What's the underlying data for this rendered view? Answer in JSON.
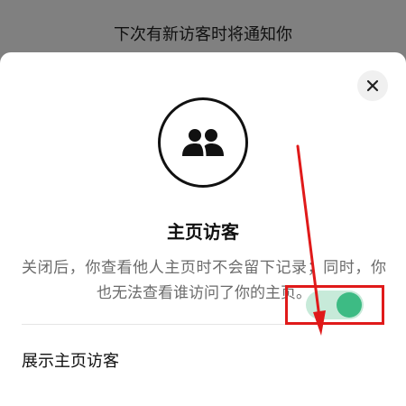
{
  "banner": {
    "text": "下次有新访客时将通知你"
  },
  "dialog": {
    "title": "主页访客",
    "description": "关闭后，你查看他人主页时不会留下记录；同时，你也无法查看谁访问了你的主页。",
    "close_icon": "close-icon",
    "hero_icon": "users-icon"
  },
  "setting": {
    "label": "展示主页访客",
    "toggle_on": true
  },
  "colors": {
    "overlay": "#808080",
    "toggle_track": "#c7ead9",
    "toggle_knob": "#3dbb84",
    "annotation": "#e01a1a"
  }
}
